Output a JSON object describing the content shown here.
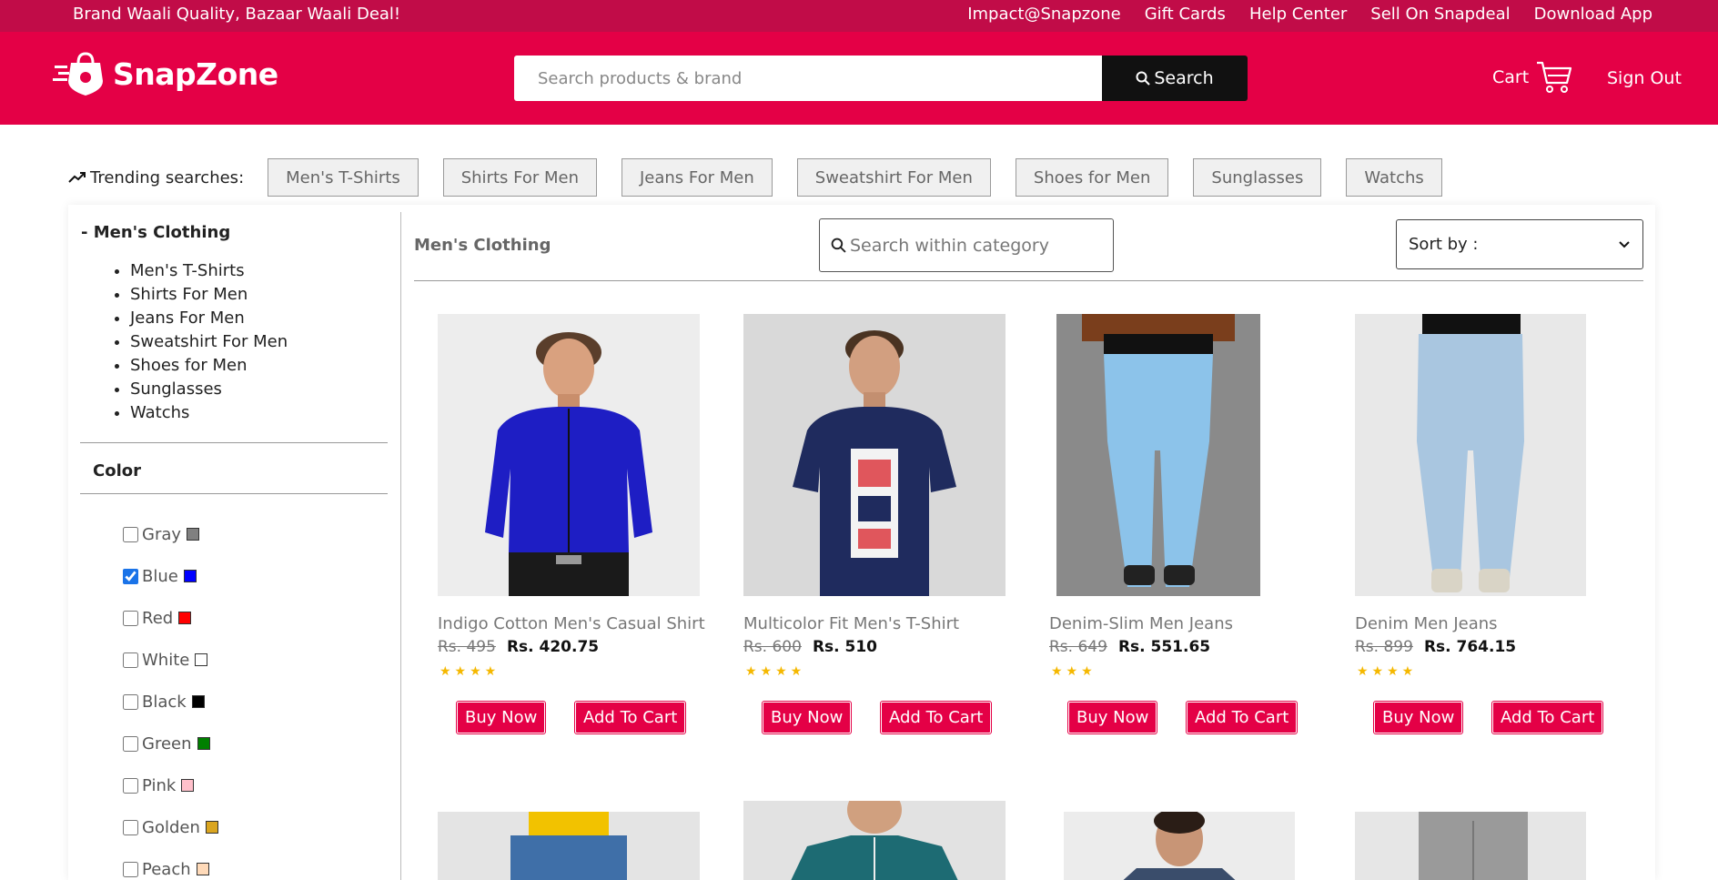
{
  "topbar": {
    "tagline": "Brand Waali Quality, Bazaar Waali Deal!",
    "links": [
      "Impact@Snapzone",
      "Gift Cards",
      "Help Center",
      "Sell On Snapdeal",
      "Download App"
    ]
  },
  "header": {
    "logo_text": "SnapZone",
    "search_placeholder": "Search products & brand",
    "search_button": "Search",
    "cart_label": "Cart",
    "signout_label": "Sign Out"
  },
  "trending": {
    "label": "Trending searches:",
    "chips": [
      "Men's T-Shirts",
      "Shirts For Men",
      "Jeans For Men",
      "Sweatshirt For Men",
      "Shoes for Men",
      "Sunglasses",
      "Watchs"
    ]
  },
  "sidebar": {
    "category_title": "- Men's Clothing",
    "categories": [
      "Men's T-Shirts",
      "Shirts For Men",
      "Jeans For Men",
      "Sweatshirt For Men",
      "Shoes for Men",
      "Sunglasses",
      "Watchs"
    ],
    "color_title": "Color",
    "colors": [
      {
        "label": "Gray",
        "hex": "#808080",
        "checked": false
      },
      {
        "label": "Blue",
        "hex": "#0000ff",
        "checked": true
      },
      {
        "label": "Red",
        "hex": "#ff0000",
        "checked": false
      },
      {
        "label": "White",
        "hex": "#ffffff",
        "checked": false
      },
      {
        "label": "Black",
        "hex": "#000000",
        "checked": false
      },
      {
        "label": "Green",
        "hex": "#008000",
        "checked": false
      },
      {
        "label": "Pink",
        "hex": "#ffc0cb",
        "checked": false
      },
      {
        "label": "Golden",
        "hex": "#daa520",
        "checked": false
      },
      {
        "label": "Peach",
        "hex": "#ffdab9",
        "checked": false
      }
    ]
  },
  "content": {
    "title": "Men's Clothing",
    "search_placeholder": "Search within category",
    "sort_label": "Sort by :",
    "buy_label": "Buy Now",
    "cart_label": "Add To Cart",
    "products": [
      {
        "name": "Indigo Cotton Men's Casual Shirt",
        "old_price": "Rs. 495",
        "new_price": "Rs. 420.75",
        "stars": 4
      },
      {
        "name": "Multicolor Fit Men's T-Shirt",
        "old_price": "Rs. 600",
        "new_price": "Rs. 510",
        "stars": 4
      },
      {
        "name": "Denim-Slim Men Jeans",
        "old_price": "Rs. 649",
        "new_price": "Rs. 551.65",
        "stars": 3
      },
      {
        "name": "Denim Men Jeans",
        "old_price": "Rs. 899",
        "new_price": "Rs. 764.15",
        "stars": 4
      }
    ]
  },
  "colors": {
    "brand": "#e40046",
    "topbar": "#c10c48"
  }
}
